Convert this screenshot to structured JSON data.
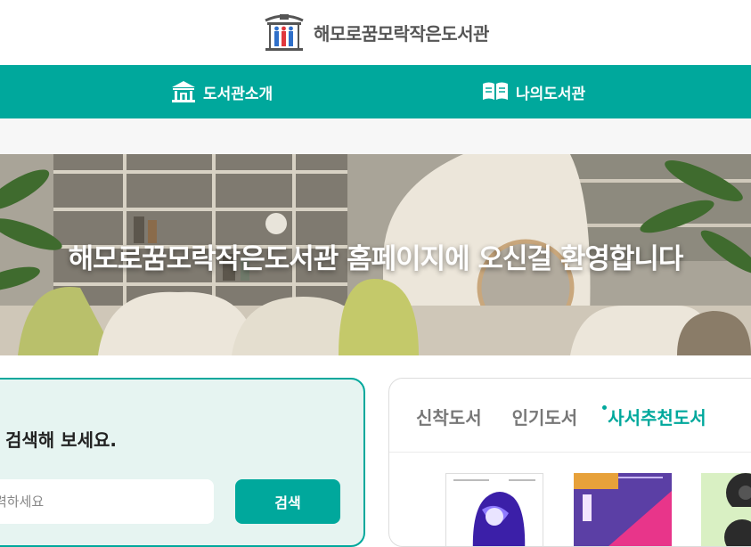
{
  "header": {
    "title": "해모로꿈모락작은도서관"
  },
  "nav": {
    "items": [
      {
        "label": "도서관소개",
        "icon": "library-building-icon"
      },
      {
        "label": "나의도서관",
        "icon": "open-book-icon"
      }
    ]
  },
  "hero": {
    "title": "해모로꿈모락작은도서관 홈페이지에 오신걸 환영합니다"
  },
  "search": {
    "heading": "검색해 보세요.",
    "placeholder": "력하세요",
    "button_label": "검색"
  },
  "books": {
    "tabs": [
      {
        "label": "신착도서",
        "active": false
      },
      {
        "label": "인기도서",
        "active": false
      },
      {
        "label": "사서추천도서",
        "active": true
      }
    ],
    "covers": [
      {
        "style": "white cover with purple figure"
      },
      {
        "style": "purple and pink cover"
      },
      {
        "style": "light green cover with dark circles"
      }
    ]
  },
  "colors": {
    "accent": "#00a89c",
    "search_panel_bg": "#e6f4f1",
    "nav_text": "#ffffff"
  }
}
